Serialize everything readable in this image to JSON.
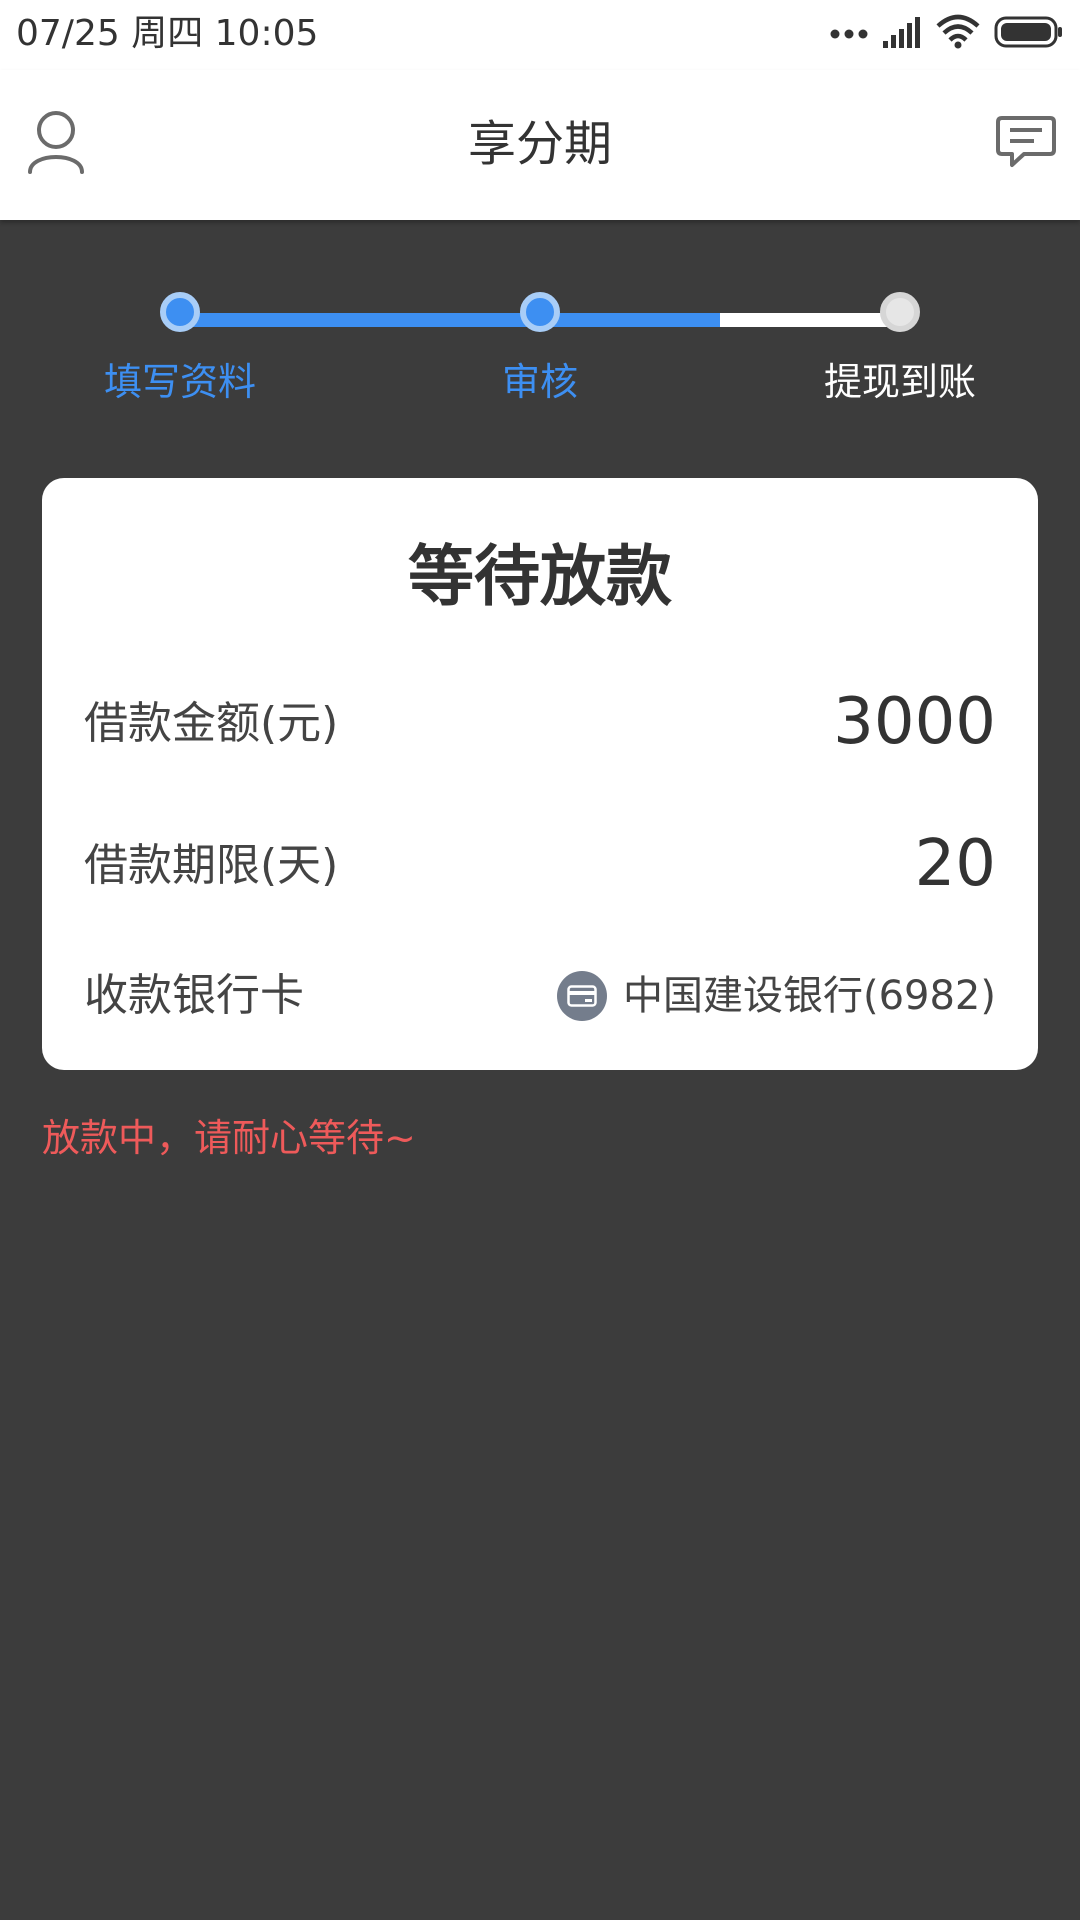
{
  "status_bar": {
    "time": "07/25  周四  10:05",
    "icons": [
      "more-dots-icon",
      "signal-icon",
      "wifi-icon",
      "battery-icon"
    ]
  },
  "header": {
    "title": "享分期",
    "left_icon": "user-icon",
    "right_icon": "message-icon"
  },
  "progress": {
    "steps": [
      {
        "label": "填写资料",
        "state": "done"
      },
      {
        "label": "审核",
        "state": "done"
      },
      {
        "label": "提现到账",
        "state": "pending"
      }
    ],
    "progress_fraction": 0.8
  },
  "card": {
    "title": "等待放款",
    "amount_label": "借款金额(元)",
    "amount_value": "3000",
    "term_label": "借款期限(天)",
    "term_value": "20",
    "bank_label": "收款银行卡",
    "bank_icon": "bank-card-icon",
    "bank_value": "中国建设银行(6982)"
  },
  "notice": "放款中，请耐心等待~",
  "colors": {
    "accent": "#3d8ff2",
    "background": "#3c3c3c",
    "notice": "#ee5a5a",
    "card": "#ffffff"
  }
}
